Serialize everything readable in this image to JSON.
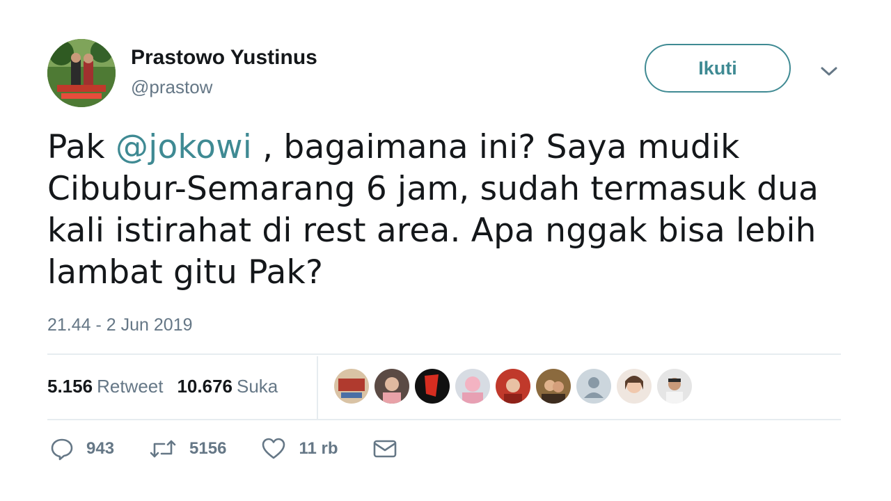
{
  "user": {
    "display_name": "Prastowo Yustinus",
    "handle": "@prastow"
  },
  "follow_button": {
    "label": "Ikuti"
  },
  "tweet": {
    "prefix": "Pak ",
    "mention": "@jokowi",
    "text_after_mention": " , bagaimana ini? Saya mudik Cibubur-Semarang 6 jam, sudah termasuk dua kali istirahat di rest area. Apa nggak bisa lebih lambat gitu Pak?",
    "timestamp": "21.44 - 2 Jun 2019"
  },
  "stats": {
    "retweets": "5.156",
    "retweets_label": "Retweet",
    "likes": "10.676",
    "likes_label": "Suka"
  },
  "actions": {
    "replies": "943",
    "retweets": "5156",
    "likes": "11 rb"
  },
  "colors": {
    "accent": "#3f8a93",
    "text": "#14171a",
    "muted": "#657786",
    "divider": "#e6ecf0"
  },
  "icons": {
    "reply": "reply-icon",
    "retweet": "retweet-icon",
    "like": "heart-icon",
    "message": "envelope-icon",
    "caret": "chevron-down-icon"
  }
}
